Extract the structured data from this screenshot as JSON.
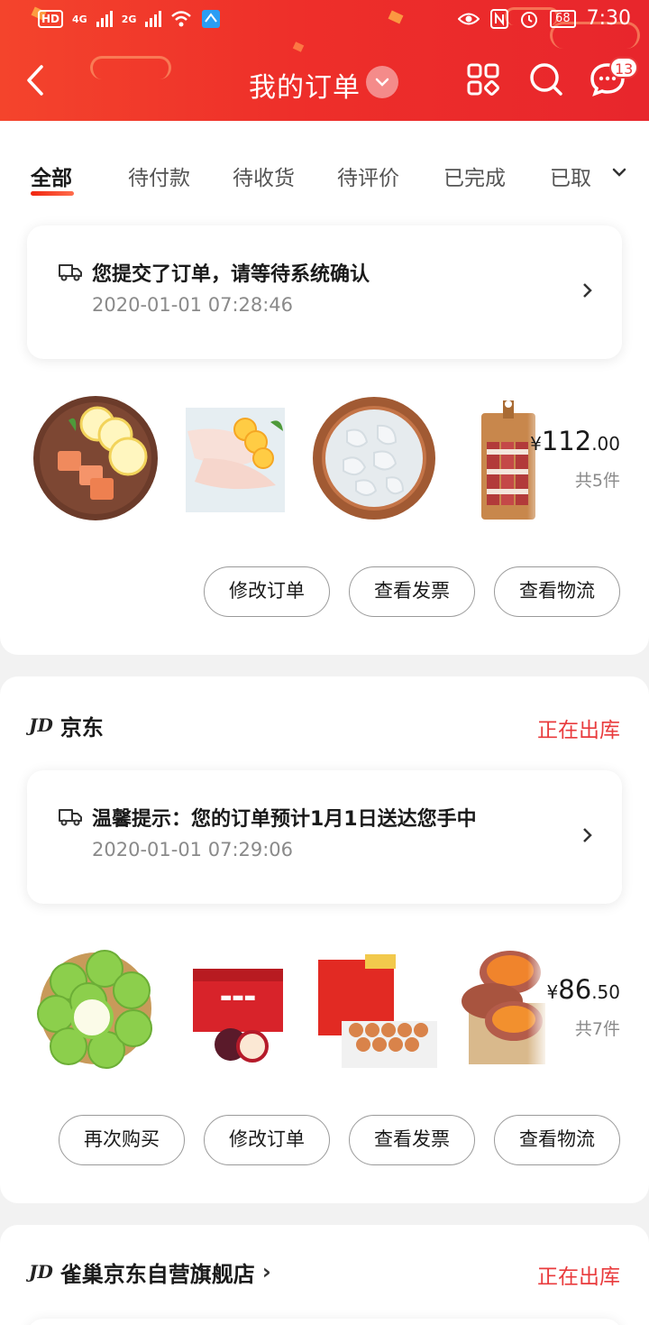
{
  "status_bar": {
    "hd_badge": "HD",
    "sim1_net": "4G",
    "sim2_net": "2G",
    "battery": "68",
    "time": "7:30"
  },
  "header": {
    "title": "我的订单",
    "message_badge": "13"
  },
  "tabs": [
    "全部",
    "待付款",
    "待收货",
    "待评价",
    "已完成",
    "已取"
  ],
  "orders": [
    {
      "notice_text": "您提交了订单，请等待系统确认",
      "notice_time": "2020-01-01 07:28:46",
      "price_symbol": "¥",
      "price_int": "112",
      "price_dec": ".00",
      "item_count": "共5件",
      "products": [
        "salmon-plate",
        "fish-fillet",
        "shrimp-bowl",
        "ribs-board"
      ],
      "buttons": [
        "修改订单",
        "查看发票",
        "查看物流"
      ]
    },
    {
      "jd_logo": "JD",
      "shop": "京东",
      "status": "正在出库",
      "notice_text": "温馨提示：您的订单预计1月1日送达您手中",
      "notice_time": "2020-01-01 07:29:06",
      "price_symbol": "¥",
      "price_int": "86",
      "price_dec": ".50",
      "item_count": "共7件",
      "products": [
        "green-apples",
        "apple-gift-box",
        "egg-carton",
        "sweet-potatoes"
      ],
      "buttons": [
        "再次购买",
        "修改订单",
        "查看发票",
        "查看物流"
      ]
    },
    {
      "jd_logo": "JD",
      "shop": "雀巢京东自营旗舰店",
      "shop_arrow": "›",
      "status": "正在出库"
    }
  ],
  "colors": {
    "header_red": "#ee2f2a",
    "accent_red": "#e93b3d",
    "background": "#f2f2f2"
  }
}
